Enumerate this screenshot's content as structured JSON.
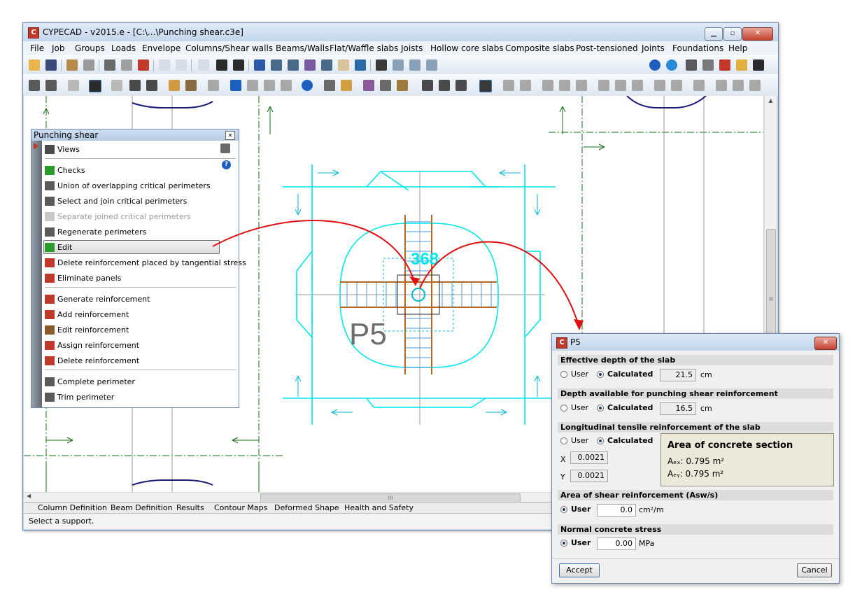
{
  "window": {
    "title": "CYPECAD - v2015.e - [C:\\...\\Punching shear.c3e]"
  },
  "menu": [
    "File",
    "Job",
    "Groups",
    "Loads",
    "Envelope",
    "Columns/Shear walls",
    "Beams/Walls",
    "Flat/Waffle slabs",
    "Joists",
    "Hollow core slabs",
    "Composite slabs",
    "Post-tensioned",
    "Joints",
    "Foundations",
    "Help"
  ],
  "tabs": [
    "Column Definition",
    "Beam Definition",
    "Results",
    "Contour Maps",
    "Deformed Shape",
    "Health and Safety"
  ],
  "status": "Select a support.",
  "scroll_marker": "III",
  "vscroll_marker": "≡",
  "drawing": {
    "column_label": "P5",
    "overlay_number": "368"
  },
  "panel": {
    "title": "Punching shear",
    "items": [
      {
        "label": "Views",
        "icon": "views-icon"
      },
      {
        "label": "Checks",
        "icon": "checks-icon"
      },
      {
        "label": "Union of overlapping critical perimeters",
        "icon": "union-perimeters-icon"
      },
      {
        "label": "Select and join critical perimeters",
        "icon": "join-perimeters-icon"
      },
      {
        "label": "Separate joined critical perimeters",
        "icon": "separate-perimeters-icon",
        "disabled": true
      },
      {
        "label": "Regenerate perimeters",
        "icon": "regenerate-icon"
      },
      {
        "label": "Edit",
        "icon": "edit-icon",
        "selected": true
      },
      {
        "label": "Delete reinforcement placed by tangential stress",
        "icon": "delete-tangential-icon"
      },
      {
        "label": "Eliminate panels",
        "icon": "eliminate-panels-icon"
      },
      {
        "label": "Generate reinforcement",
        "icon": "generate-reinforcement-icon"
      },
      {
        "label": "Add reinforcement",
        "icon": "add-reinforcement-icon"
      },
      {
        "label": "Edit reinforcement",
        "icon": "edit-reinforcement-icon"
      },
      {
        "label": "Assign reinforcement",
        "icon": "assign-reinforcement-icon"
      },
      {
        "label": "Delete reinforcement",
        "icon": "delete-reinforcement-icon"
      },
      {
        "label": "Complete perimeter",
        "icon": "complete-perimeter-icon"
      },
      {
        "label": "Trim perimeter",
        "icon": "trim-perimeter-icon"
      }
    ]
  },
  "dialog": {
    "title": "P5",
    "sections": {
      "effective_depth": "Effective depth of the slab",
      "depth_available": "Depth available for punching shear reinforcement",
      "longitudinal": "Longitudinal tensile reinforcement of the slab",
      "shear_area": "Area of shear reinforcement (Asw/s)",
      "normal_stress": "Normal concrete stress"
    },
    "options": {
      "user": "User",
      "calculated": "Calculated"
    },
    "effective_depth": {
      "value": "21.5",
      "unit": "cm",
      "selected": "Calculated"
    },
    "depth_available": {
      "value": "16.5",
      "unit": "cm",
      "selected": "Calculated"
    },
    "longitudinal": {
      "selected": "Calculated",
      "x_label": "X",
      "x_value": "0.0021",
      "y_label": "Y",
      "y_value": "0.0021"
    },
    "concrete_section": {
      "title": "Area of concrete section",
      "ax": "Aₑₓ: 0.795 m²",
      "ay": "Aₑᵧ: 0.795 m²"
    },
    "shear_area": {
      "value": "0.0",
      "unit": "cm²/m",
      "selected": "User"
    },
    "normal_stress": {
      "value": "0.00",
      "unit": "MPa",
      "selected": "User"
    },
    "accept": "Accept",
    "cancel": "Cancel"
  },
  "colors": {
    "drawing": "#00e5ee",
    "rebar": "#b5651d",
    "annotation_arrow": "#e01010",
    "axis": "#127012",
    "title_bar": "#c4d6ec"
  }
}
